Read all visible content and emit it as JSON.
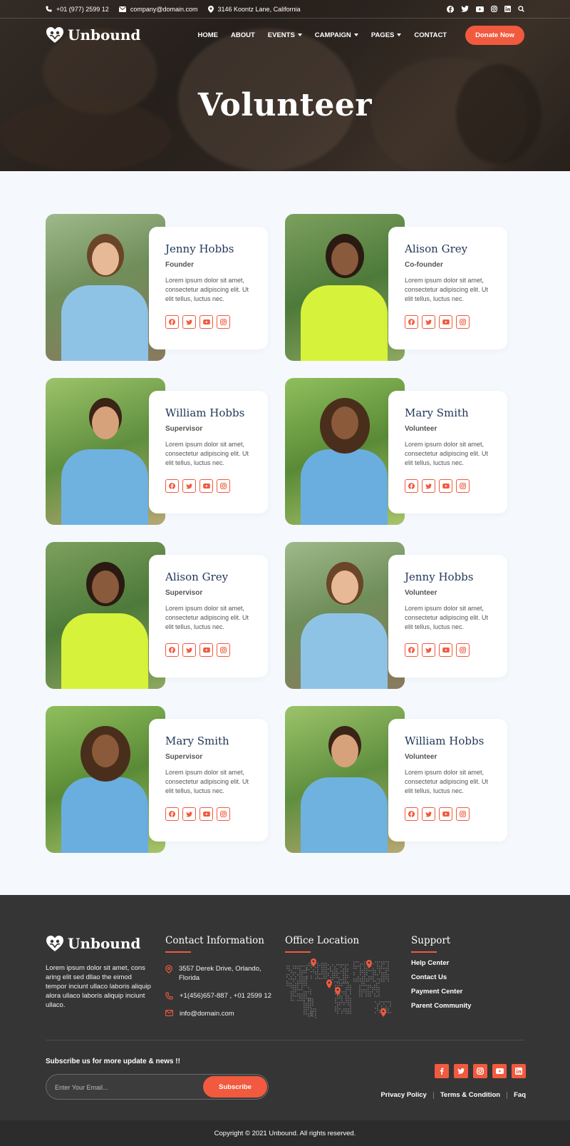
{
  "topbar": {
    "phone": "+01 (977) 2599 12",
    "email": "company@domain.com",
    "address": "3146 Koontz Lane, California"
  },
  "brand": {
    "name": "Unbound"
  },
  "nav": {
    "items": [
      {
        "label": "HOME",
        "dropdown": false
      },
      {
        "label": "ABOUT",
        "dropdown": false
      },
      {
        "label": "EVENTS",
        "dropdown": true
      },
      {
        "label": "CAMPAIGN",
        "dropdown": true
      },
      {
        "label": "PAGES",
        "dropdown": true
      },
      {
        "label": "CONTACT",
        "dropdown": false
      }
    ],
    "cta": "Donate Now"
  },
  "hero": {
    "title": "Volunteer"
  },
  "volunteers": [
    {
      "name": "Jenny Hobbs",
      "role": "Founder",
      "bio": "Lorem ipsum dolor sit amet, consectetur adipiscing elit. Ut elit tellus, luctus nec."
    },
    {
      "name": "Alison Grey",
      "role": "Co-founder",
      "bio": "Lorem ipsum dolor sit amet, consectetur adipiscing elit. Ut elit tellus, luctus nec."
    },
    {
      "name": "William Hobbs",
      "role": "Supervisor",
      "bio": "Lorem ipsum dolor sit amet, consectetur adipiscing elit. Ut elit tellus, luctus nec."
    },
    {
      "name": "Mary Smith",
      "role": "Volunteer",
      "bio": "Lorem ipsum dolor sit amet, consectetur adipiscing elit. Ut elit tellus, luctus nec."
    },
    {
      "name": "Alison Grey",
      "role": "Supervisor",
      "bio": "Lorem ipsum dolor sit amet, consectetur adipiscing elit. Ut elit tellus, luctus nec."
    },
    {
      "name": "Jenny Hobbs",
      "role": "Volunteer",
      "bio": "Lorem ipsum dolor sit amet, consectetur adipiscing elit. Ut elit tellus, luctus nec."
    },
    {
      "name": "Mary Smith",
      "role": "Supervisor",
      "bio": "Lorem ipsum dolor sit amet, consectetur adipiscing elit. Ut elit tellus, luctus nec."
    },
    {
      "name": "William Hobbs",
      "role": "Volunteer",
      "bio": "Lorem ipsum dolor sit amet, consectetur adipiscing elit. Ut elit tellus, luctus nec."
    }
  ],
  "footer": {
    "about": "Lorem ipsum dolor sit amet, cons aring elit sed dllao the eimod tempor inciunt ullaco laboris aliquip alora ullaco laboris aliquip inciunt ullaco.",
    "contact_title": "Contact Information",
    "contact_address": "3557 Derek Drive, Orlando, Florida",
    "contact_phone": "+1(456)657-887 , +01 2599 12",
    "contact_email": "info@domain.com",
    "office_title": "Office Location",
    "support_title": "Support",
    "support_links": [
      "Help Center",
      "Contact Us",
      "Payment Center",
      "Parent Community"
    ],
    "subscribe_title": "Subscribe us for more update & news !!",
    "email_placeholder": "Enter Your Email...",
    "subscribe_button": "Subscribe",
    "legal_links": [
      "Privacy Policy",
      "Terms & Condition",
      "Faq"
    ],
    "copyright": "Copyright © 2021 Unbound. All rights reserved."
  },
  "colors": {
    "accent": "#f15a3e",
    "heading": "#1f3556",
    "footer_bg": "#353535"
  }
}
